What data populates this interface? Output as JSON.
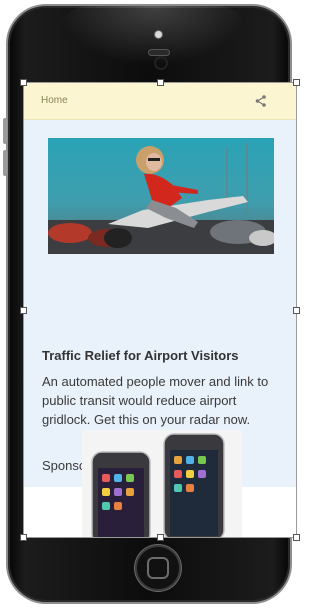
{
  "header": {
    "home_label": "Home",
    "share_icon": "share-icon"
  },
  "card": {
    "image_icon": "woman-riding-scooter-photo",
    "title": "Traffic Relief for Airport Visitors",
    "description": "An automated people mover and link to public transit would reduce airport gridlock. Get this on your radar now.",
    "sponsor": "Sponsored by LAX"
  },
  "product": {
    "image_icon": "smartphones-photo"
  },
  "colors": {
    "header_bg": "#fcf5d2",
    "card_bg": "#e9f1fb",
    "home_text": "#8a8152",
    "frame": "#0c0c0c"
  }
}
